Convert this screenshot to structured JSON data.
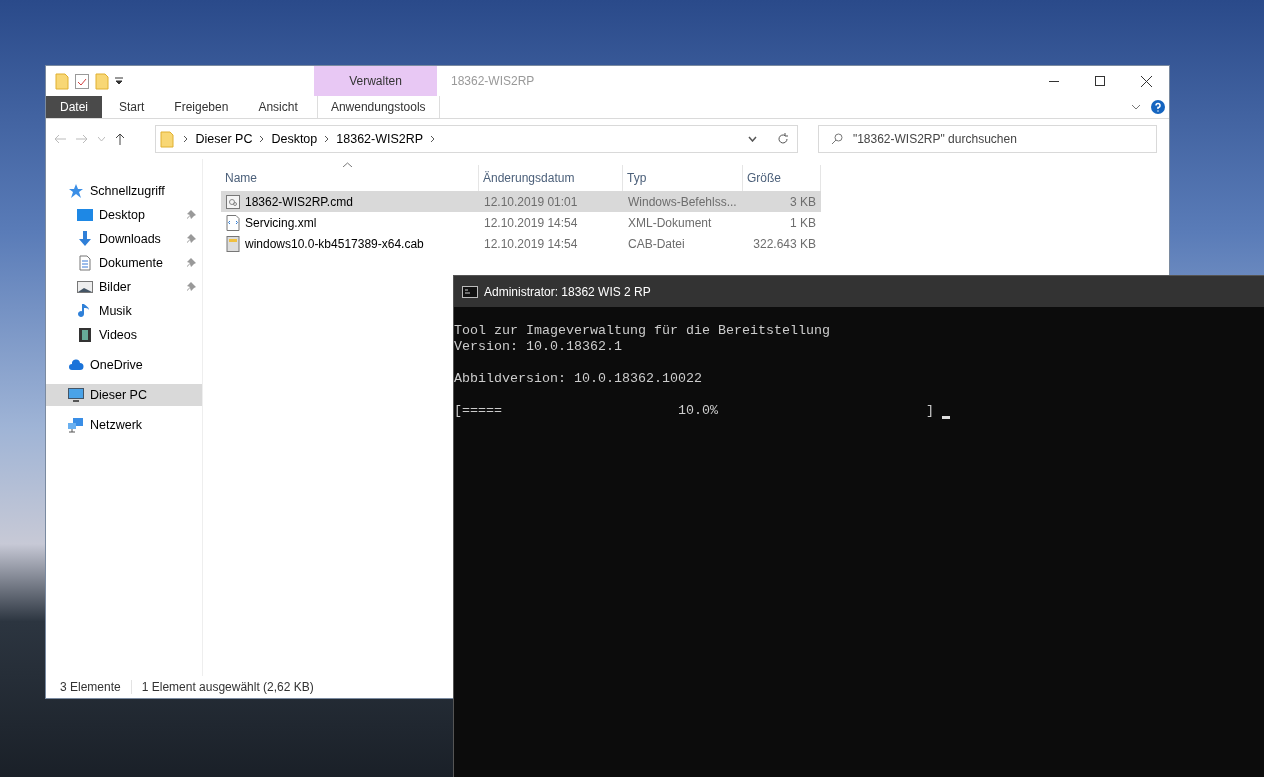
{
  "explorer": {
    "title": "18362-WIS2RP",
    "context_tab": "Verwalten",
    "ribbon_tabs": [
      {
        "label": "Datei",
        "kind": "file"
      },
      {
        "label": "Start",
        "kind": "tab"
      },
      {
        "label": "Freigeben",
        "kind": "tab"
      },
      {
        "label": "Ansicht",
        "kind": "tab"
      },
      {
        "label": "Anwendungstools",
        "kind": "context"
      }
    ],
    "breadcrumbs": [
      "Dieser PC",
      "Desktop",
      "18362-WIS2RP"
    ],
    "search": {
      "placeholder": "\"18362-WIS2RP\" durchsuchen"
    },
    "sidebar": [
      {
        "label": "Schnellzugriff",
        "kind": "star",
        "selected": false,
        "children": [
          {
            "label": "Desktop",
            "kind": "desktop",
            "pinned": true,
            "selected": false
          },
          {
            "label": "Downloads",
            "kind": "download",
            "pinned": true,
            "selected": false
          },
          {
            "label": "Dokumente",
            "kind": "document",
            "pinned": true,
            "selected": false
          },
          {
            "label": "Bilder",
            "kind": "picture",
            "pinned": true,
            "selected": false
          },
          {
            "label": "Musik",
            "kind": "music",
            "pinned": false,
            "selected": false
          },
          {
            "label": "Videos",
            "kind": "film",
            "pinned": false,
            "selected": false
          }
        ]
      },
      {
        "label": "OneDrive",
        "kind": "cloud",
        "selected": false
      },
      {
        "label": "Dieser PC",
        "kind": "computer",
        "selected": true
      },
      {
        "label": "Netzwerk",
        "kind": "network",
        "selected": false
      }
    ],
    "columns": [
      "Name",
      "Änderungsdatum",
      "Typ",
      "Größe"
    ],
    "rows": [
      {
        "name": "18362-WIS2RP.cmd",
        "kind": "cmd",
        "date": "12.10.2019 01:01",
        "type": "Windows-Befehlss...",
        "size": "3 KB",
        "selected": true
      },
      {
        "name": "Servicing.xml",
        "kind": "xml",
        "date": "12.10.2019 14:54",
        "type": "XML-Dokument",
        "size": "1 KB",
        "selected": false
      },
      {
        "name": "windows10.0-kb4517389-x64.cab",
        "kind": "cab",
        "date": "12.10.2019 14:54",
        "type": "CAB-Datei",
        "size": "322.643 KB",
        "selected": false
      }
    ],
    "status_bar": [
      "3 Elemente",
      "1 Element ausgewählt (2,62 KB)"
    ]
  },
  "console": {
    "title": "Administrator:  18362 WIS 2 RP",
    "blocks": [
      [
        "Tool zur Imageverwaltung für die Bereitstellung",
        "Version: 10.0.18362.1"
      ],
      [
        "Abbildversion: 10.0.18362.10022"
      ],
      [
        "[=====                      10.0%                          ]"
      ]
    ]
  }
}
